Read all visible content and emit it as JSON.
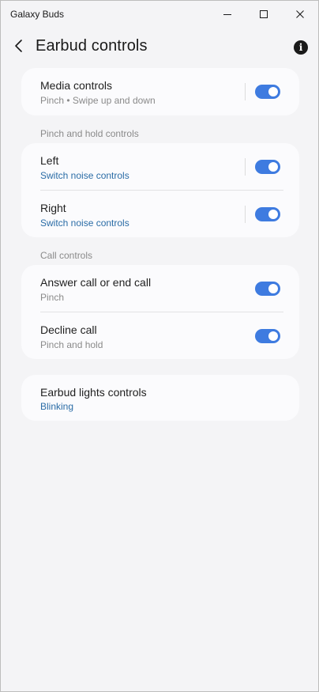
{
  "window": {
    "app_title": "Galaxy Buds",
    "minimize_label": "Minimize",
    "maximize_label": "Maximize",
    "close_label": "Close"
  },
  "header": {
    "title": "Earbud controls",
    "info_glyph": "i"
  },
  "media": {
    "title": "Media controls",
    "subtitle": "Pinch • Swipe up and down",
    "enabled": true
  },
  "pinch_hold": {
    "section_label": "Pinch and hold controls",
    "left": {
      "title": "Left",
      "subtitle": "Switch noise controls",
      "enabled": true
    },
    "right": {
      "title": "Right",
      "subtitle": "Switch noise controls",
      "enabled": true
    }
  },
  "call": {
    "section_label": "Call controls",
    "answer": {
      "title": "Answer call or end call",
      "subtitle": "Pinch",
      "enabled": true
    },
    "decline": {
      "title": "Decline call",
      "subtitle": "Pinch and hold",
      "enabled": true
    }
  },
  "lights": {
    "title": "Earbud lights controls",
    "subtitle": "Blinking"
  },
  "colors": {
    "accent": "#3e7be0",
    "link_text": "#2a6ca6",
    "background": "#f4f4f6",
    "card": "#fbfbfd"
  }
}
